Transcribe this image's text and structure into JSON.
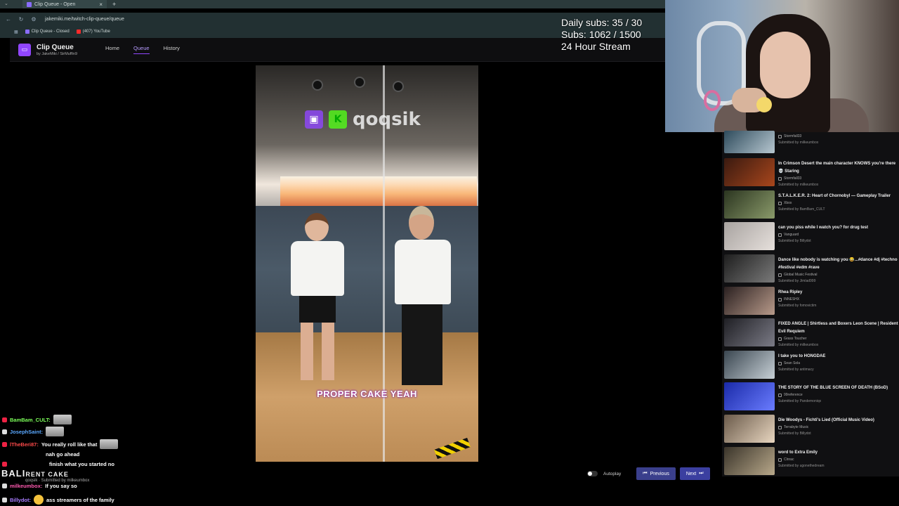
{
  "browser": {
    "tab_title": "Clip Queue - Open",
    "url": "jakemiki.me/twitch-clip-queue/queue",
    "bookmarks": [
      {
        "label": "Clip Queue - Closed",
        "color": "#8a6cff"
      },
      {
        "label": "(407) YouTube",
        "color": "#ff2a2a"
      }
    ]
  },
  "app": {
    "title": "Clip Queue",
    "byline_prefix": "by",
    "author1": "JakeMiki",
    "author2": "SirMuffin9",
    "nav": [
      {
        "label": "Home",
        "active": false
      },
      {
        "label": "Queue",
        "active": true
      },
      {
        "label": "History",
        "active": false
      }
    ]
  },
  "overlay": {
    "daily_subs": "Daily subs: 35 / 30",
    "subs": "Subs: 1062 / 1500",
    "stream": "24 Hour Stream"
  },
  "player": {
    "watermark": "qoqsik",
    "caption": "PROPER CAKE YEAH"
  },
  "queue": [
    {
      "title": "",
      "channel": "Stormfall33",
      "submitted": "Submitted by milkeumbox",
      "thumb": [
        "#2e4b5c",
        "#b7c7d0"
      ]
    },
    {
      "title": "In Crimson Desert the main character KNOWS you're there 💀 Staring",
      "channel": "Stormfall33",
      "submitted": "Submitted by milkeumbox",
      "thumb": [
        "#3a1a10",
        "#a8461c"
      ]
    },
    {
      "title": "S.T.A.L.K.E.R. 2: Heart of Chornobyl — Gameplay Trailer",
      "channel": "Xbox",
      "submitted": "Submitted by BamBam_CULT",
      "thumb": [
        "#2b3520",
        "#8a9a6a"
      ]
    },
    {
      "title": "can you piss while I watch you? for drug test",
      "channel": "Vanguard",
      "submitted": "Submitted by Billydot",
      "thumb": [
        "#a8a3a0",
        "#e6e0dc"
      ]
    },
    {
      "title": "Dance like nobody is watching you 😂...#dance #dj #techno #festival #edm #rave",
      "channel": "Global Music Festival",
      "submitted": "Submitted by Jimlad999",
      "thumb": [
        "#1e1e1e",
        "#7a7a7a"
      ]
    },
    {
      "title": "Rhea Ripley",
      "channel": "INNESHX",
      "submitted": "Submitted by fomovictim",
      "thumb": [
        "#2a2020",
        "#b89a8a"
      ]
    },
    {
      "title": "FIXED ANGLE | Shirtless and Boxers Leon Scene | Resident Evil Requiem",
      "channel": "Grass Toucher",
      "submitted": "Submitted by milkeumbox",
      "thumb": [
        "#1f1f24",
        "#7b7b86"
      ]
    },
    {
      "title": "I take you to HONGDAE",
      "channel": "Sean Sola",
      "submitted": "Submitted by antimacy",
      "thumb": [
        "#3a4650",
        "#c7d0d6"
      ]
    },
    {
      "title": "THE STORY OF THE BLUE SCREEN OF DEATH (BSoD)",
      "channel": "99reference",
      "submitted": "Submitted by Pandemoniqx",
      "thumb": [
        "#1a2aa8",
        "#6a7cff"
      ]
    },
    {
      "title": "Die Woodys - Fichti's Lied (Official Music Video)",
      "channel": "Terrabyte Music",
      "submitted": "Submitted by Billydot",
      "thumb": [
        "#6a5a4a",
        "#e8d6c0"
      ]
    },
    {
      "title": "word to Extra Emily",
      "channel": "Clnrac",
      "submitted": "Submitted by ugonethedream",
      "thumb": [
        "#3a342a",
        "#b8a88a"
      ]
    }
  ],
  "controls": {
    "autoplay": "Autoplay",
    "autoplay_on": false,
    "previous": "Previous",
    "next": "Next"
  },
  "chat": [
    {
      "user": "BamBam_CULT:",
      "color": "#7cff5a",
      "msg": ""
    },
    {
      "user": "JosephSaint:",
      "color": "#5aa8ff",
      "msg": ""
    },
    {
      "user": "lTheBeri87:",
      "color": "#ff4a4a",
      "msg": "You really roll like that"
    },
    {
      "user": "",
      "color": "#5a7cff",
      "msg": "nah go ahead"
    },
    {
      "user": "",
      "color": "#c06aff",
      "msg": "finish what you started no"
    },
    {
      "user": "milkeumbox:",
      "color": "#ff5ab0",
      "msg": "If you say so"
    },
    {
      "user": "Billydot:",
      "color": "#a87cff",
      "msg": "ass streamers of the family"
    }
  ],
  "chat_extra": {
    "bali_text": "BALI",
    "rent_cake": "RENT CAKE",
    "submitted_line": "qoqsik · Submitted by milkeumbox"
  }
}
